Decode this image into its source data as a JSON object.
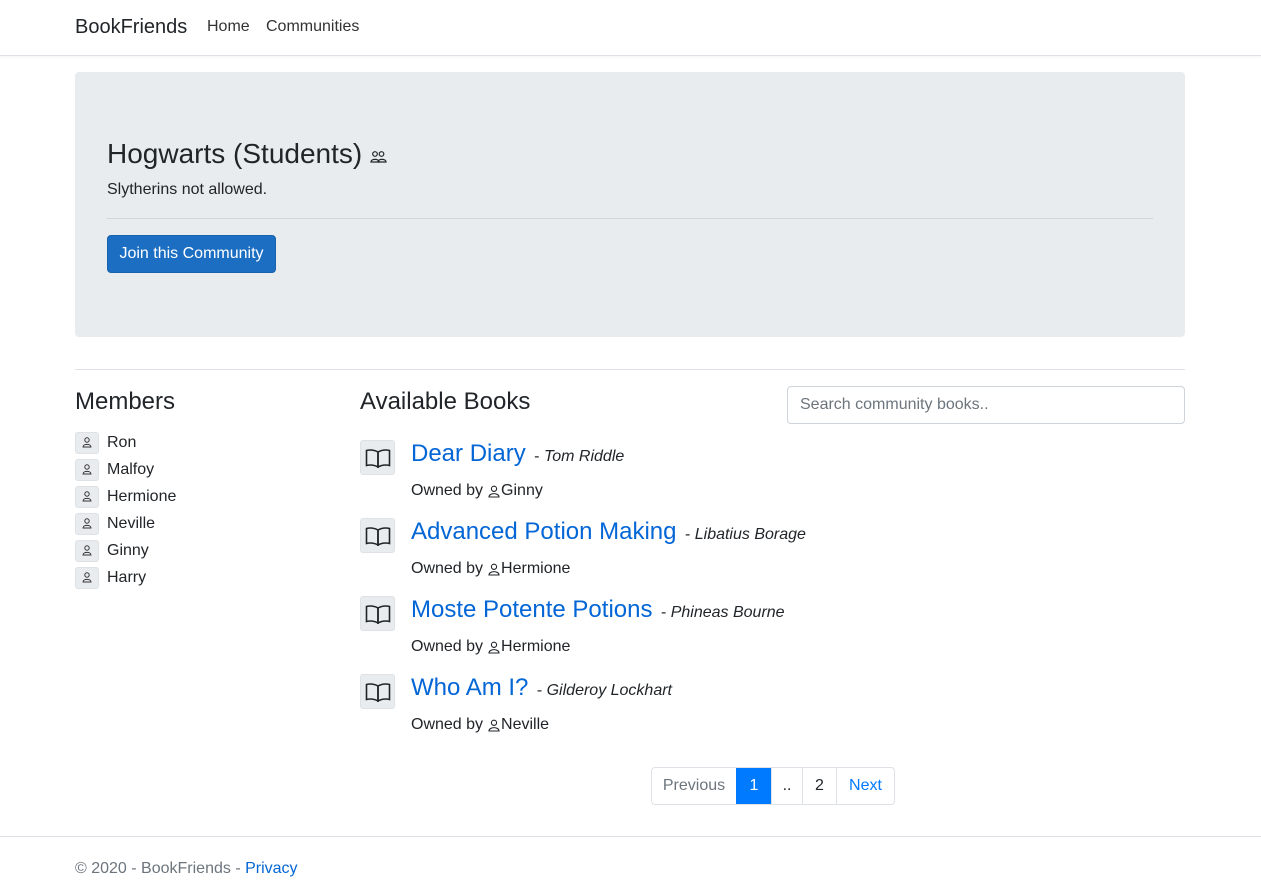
{
  "nav": {
    "brand": "BookFriends",
    "links": [
      "Home",
      "Communities"
    ]
  },
  "community": {
    "title": "Hogwarts (Students)",
    "title_icon": "people-icon",
    "description": "Slytherins not allowed.",
    "join_label": "Join this Community"
  },
  "members": {
    "heading": "Members",
    "items": [
      "Ron",
      "Malfoy",
      "Hermione",
      "Neville",
      "Ginny",
      "Harry"
    ]
  },
  "books": {
    "heading": "Available Books",
    "search_placeholder": "Search community books..",
    "owned_by_label": "Owned by",
    "separator": "-",
    "items": [
      {
        "title": "Dear Diary",
        "author": "Tom Riddle",
        "owner": "Ginny"
      },
      {
        "title": "Advanced Potion Making",
        "author": "Libatius Borage",
        "owner": "Hermione"
      },
      {
        "title": "Moste Potente Potions",
        "author": "Phineas Bourne",
        "owner": "Hermione"
      },
      {
        "title": "Who Am I?",
        "author": "Gilderoy Lockhart",
        "owner": "Neville"
      }
    ]
  },
  "pagination": {
    "previous": "Previous",
    "pages": [
      "1",
      "..",
      "2"
    ],
    "current": "1",
    "next": "Next"
  },
  "footer": {
    "text": "© 2020 - BookFriends - ",
    "privacy": "Privacy"
  },
  "colors": {
    "primary_button": "#1b6ec2",
    "link": "#0366d6",
    "active_page": "#007bff",
    "jumbotron_bg": "#e9ecef"
  }
}
